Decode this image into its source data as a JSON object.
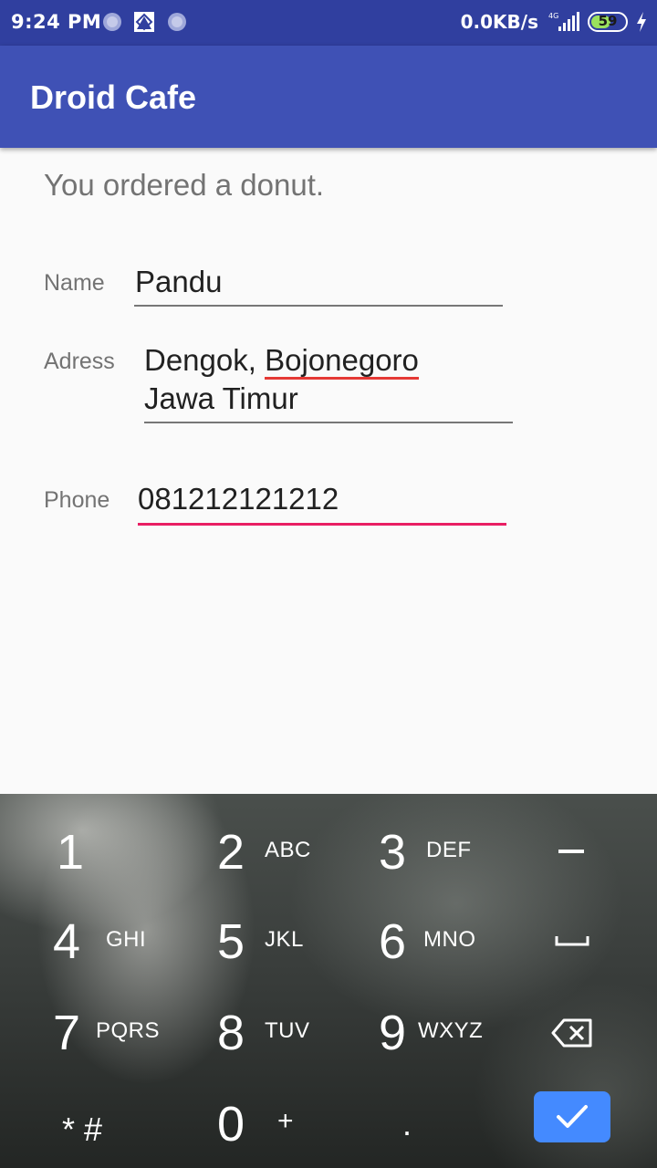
{
  "status_bar": {
    "time": "9:24 PM",
    "network_speed": "0.0KB/s",
    "signal_label": "4G",
    "battery": "59",
    "battery_level_percent": 59,
    "icons": [
      "notification-dot-icon",
      "photo-app-icon",
      "notification-dot-icon",
      "signal-icon",
      "battery-icon",
      "charging-bolt-icon"
    ]
  },
  "app_bar": {
    "title": "Droid Cafe"
  },
  "order": {
    "message": "You ordered a donut."
  },
  "form": {
    "name_label": "Name",
    "name_value": "Pandu",
    "address_label": "Adress",
    "address_line1_a": "Dengok, ",
    "address_line1_b": "Bojonegoro",
    "address_line2": "Jawa Timur",
    "phone_label": "Phone",
    "phone_value": "081212121212"
  },
  "keyboard": {
    "keys": [
      {
        "digit": "1",
        "letters": ""
      },
      {
        "digit": "2",
        "letters": "ABC"
      },
      {
        "digit": "3",
        "letters": "DEF"
      },
      {
        "digit": "4",
        "letters": "GHI"
      },
      {
        "digit": "5",
        "letters": "JKL"
      },
      {
        "digit": "6",
        "letters": "MNO"
      },
      {
        "digit": "7",
        "letters": "PQRS"
      },
      {
        "digit": "8",
        "letters": "TUV"
      },
      {
        "digit": "9",
        "letters": "WXYZ"
      },
      {
        "digit": "0",
        "letters": "+"
      }
    ],
    "star_hash": "* #",
    "period": ".",
    "side_icons": [
      "minus-icon",
      "space-icon",
      "backspace-icon",
      "check-icon"
    ],
    "accent_color": "#448aff"
  },
  "colors": {
    "status_bar": "#303f9f",
    "app_bar": "#3f51b5",
    "focus_underline": "#e91e63"
  }
}
